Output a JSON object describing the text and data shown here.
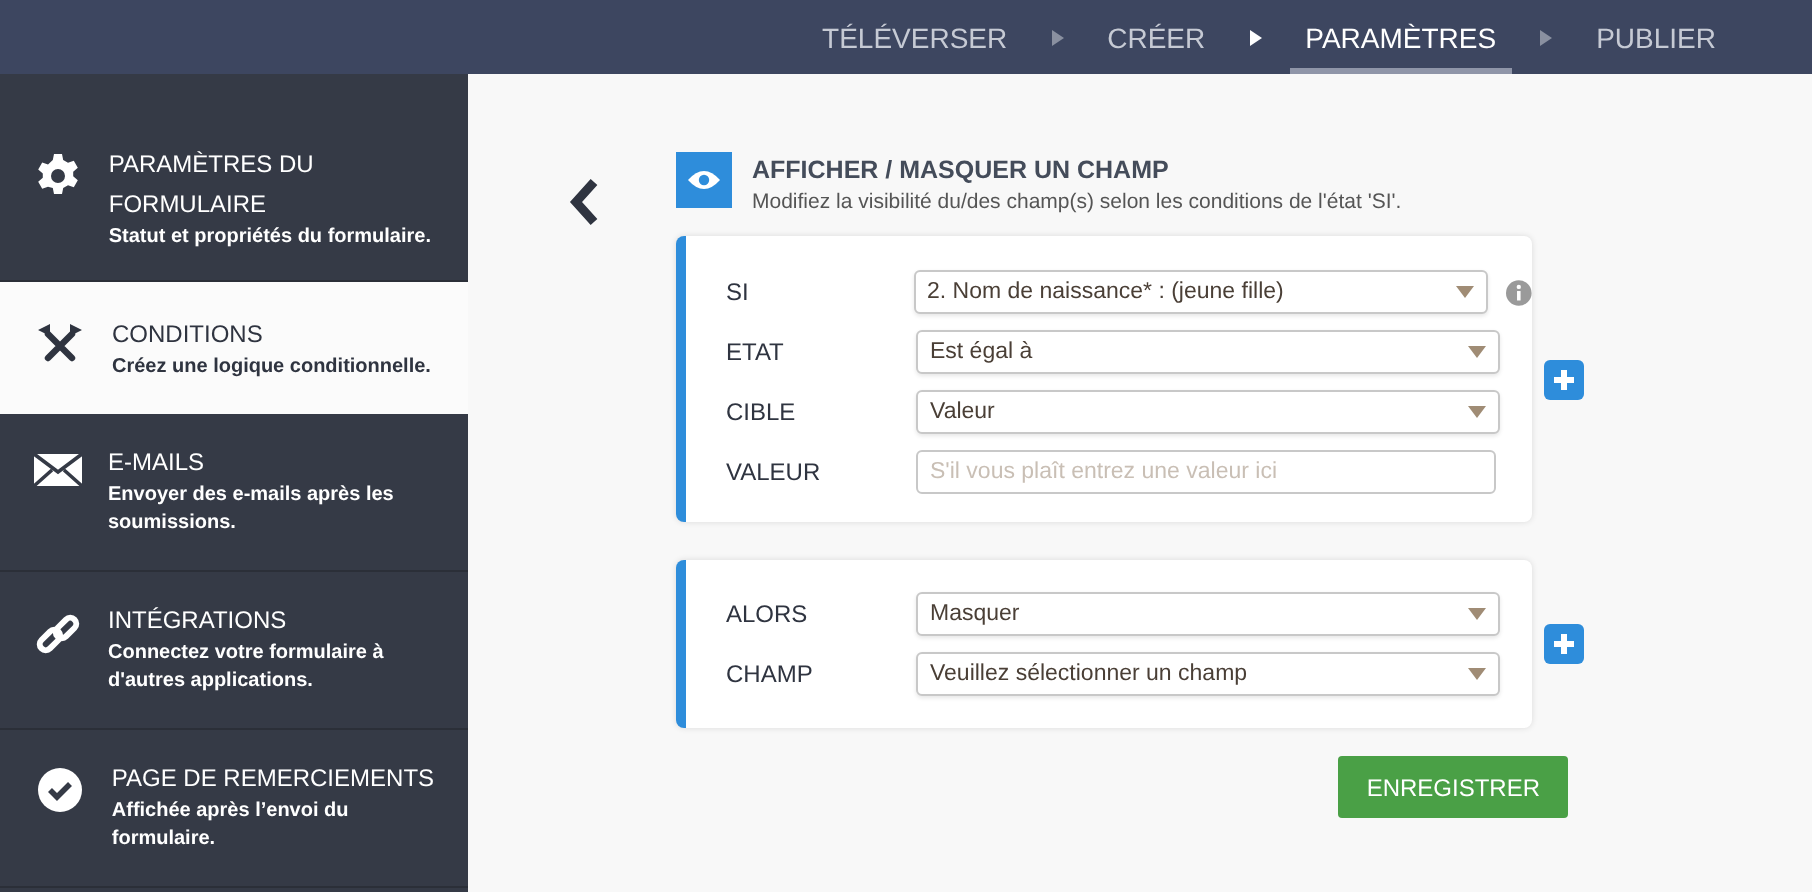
{
  "steps": [
    {
      "label": "TÉLÉVERSER",
      "selected": false
    },
    {
      "label": "CRÉER",
      "selected": false
    },
    {
      "label": "PARAMÈTRES",
      "selected": true
    },
    {
      "label": "PUBLIER",
      "selected": false
    }
  ],
  "sidebar": {
    "items": [
      {
        "title": "PARAMÈTRES DU FORMULAIRE",
        "subtitle": "Statut et propriétés du formulaire.",
        "selected": false
      },
      {
        "title": "CONDITIONS",
        "subtitle": "Créez une logique conditionnelle.",
        "selected": true
      },
      {
        "title": "E-MAILS",
        "subtitle": "Envoyer des e-mails après les soumissions.",
        "selected": false
      },
      {
        "title": "INTÉGRATIONS",
        "subtitle": "Connectez votre formulaire à d'autres applications.",
        "selected": false
      },
      {
        "title": "PAGE DE REMERCIEMENTS",
        "subtitle": "Affichée après l’envoi du formulaire.",
        "selected": false
      }
    ]
  },
  "header": {
    "title": "AFFICHER / MASQUER UN CHAMP",
    "description": "Modifiez la visibilité du/des champ(s) selon les conditions de l'état 'SI'."
  },
  "cards": [
    {
      "rows": [
        {
          "label": "SI",
          "kind": "select",
          "value": "2. Nom de naissance* : (jeune fille)",
          "info": true
        },
        {
          "label": "ETAT",
          "kind": "select",
          "value": "Est égal à",
          "info": false
        },
        {
          "label": "CIBLE",
          "kind": "select",
          "value": "Valeur",
          "info": false
        },
        {
          "label": "VALEUR",
          "kind": "text",
          "placeholder": "S'il vous plaît entrez une valeur ici",
          "info": false
        }
      ]
    },
    {
      "rows": [
        {
          "label": "ALORS",
          "kind": "select",
          "value": "Masquer",
          "info": false
        },
        {
          "label": "CHAMP",
          "kind": "select",
          "value": "Veuillez sélectionner un champ",
          "info": false
        }
      ]
    }
  ],
  "save_button": "ENREGISTRER"
}
